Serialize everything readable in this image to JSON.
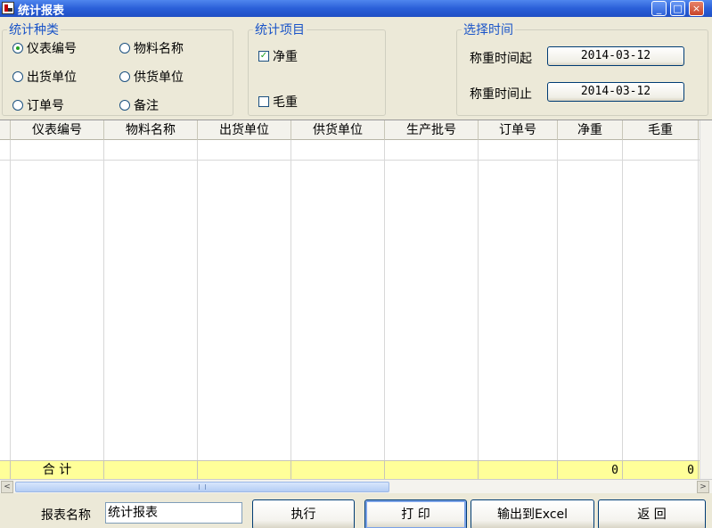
{
  "window": {
    "title": "统计报表",
    "controls": {
      "minimize": "_",
      "maximize": "□",
      "close": "×"
    }
  },
  "stat_type": {
    "legend": "统计种类",
    "options": [
      {
        "label": "仪表编号",
        "selected": true
      },
      {
        "label": "物料名称",
        "selected": false
      },
      {
        "label": "出货单位",
        "selected": false
      },
      {
        "label": "供货单位",
        "selected": false
      },
      {
        "label": "订单号",
        "selected": false
      },
      {
        "label": "备注",
        "selected": false
      }
    ]
  },
  "stat_items": {
    "legend": "统计项目",
    "net": {
      "label": "净重",
      "checked": true,
      "mark": "✓"
    },
    "gross": {
      "label": "毛重",
      "checked": false,
      "mark": ""
    }
  },
  "time": {
    "legend": "选择时间",
    "start_label": "称重时间起",
    "start_value": "2014-03-12",
    "end_label": "称重时间止",
    "end_value": "2014-03-12"
  },
  "grid": {
    "columns": [
      "仪表编号",
      "物料名称",
      "出货单位",
      "供货单位",
      "生产批号",
      "订单号",
      "净重",
      "毛重"
    ],
    "total_label": "合    计",
    "net_total": "0",
    "gross_total": "0"
  },
  "scroll": {
    "left": "<",
    "right": ">"
  },
  "footer": {
    "report_name_label": "报表名称",
    "report_name_value": "统计报表",
    "execute": "执行",
    "print": "打   印",
    "export": "输出到Excel",
    "back": "返   回"
  }
}
